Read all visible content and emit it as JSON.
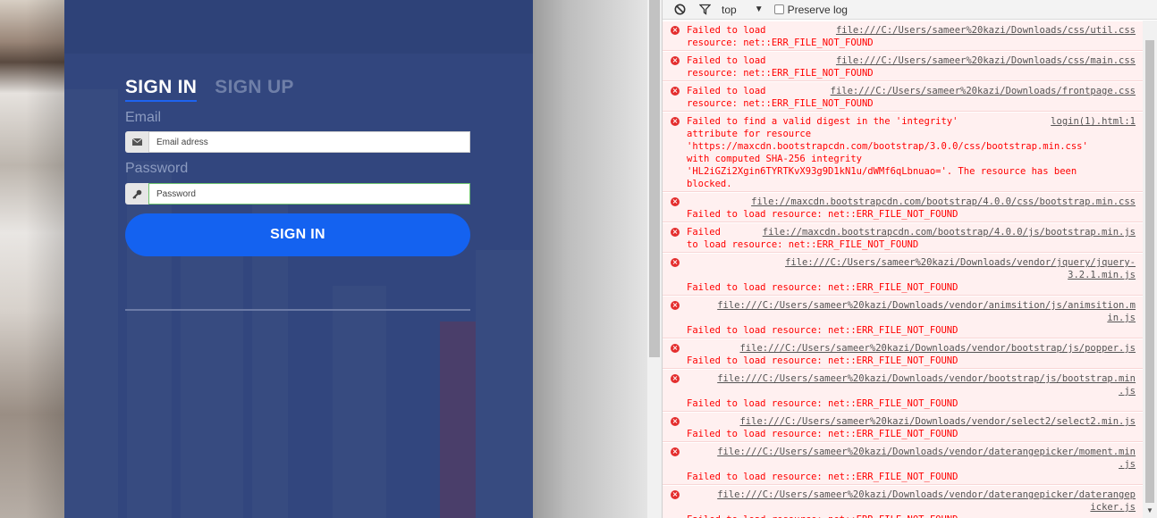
{
  "login": {
    "tabs": [
      "SIGN IN",
      "SIGN UP"
    ],
    "email_label": "Email",
    "email_placeholder": "Email adress",
    "password_label": "Password",
    "password_placeholder": "Password",
    "signin_button": "SIGN IN"
  },
  "console": {
    "context": "top",
    "preserve_log": "Preserve log",
    "entries": [
      {
        "lines": [
          [
            "Failed to load       ",
            "file:///C:/Users/sameer%20kazi/Downloads/css/util.css"
          ],
          [
            "resource: net::ERR_FILE_NOT_FOUND",
            ""
          ]
        ]
      },
      {
        "lines": [
          [
            "Failed to load       ",
            "file:///C:/Users/sameer%20kazi/Downloads/css/main.css"
          ],
          [
            "resource: net::ERR_FILE_NOT_FOUND",
            ""
          ]
        ]
      },
      {
        "lines": [
          [
            "Failed to load      ",
            "file:///C:/Users/sameer%20kazi/Downloads/frontpage.css"
          ],
          [
            "resource: net::ERR_FILE_NOT_FOUND",
            ""
          ]
        ]
      },
      {
        "lines": [
          [
            "Failed to find a valid digest in the 'integrity'",
            "login(1).html:1"
          ],
          [
            "attribute for resource",
            ""
          ],
          [
            "'https://maxcdn.bootstrapcdn.com/bootstrap/3.0.0/css/bootstrap.min.css'",
            ""
          ],
          [
            "with computed SHA-256 integrity",
            ""
          ],
          [
            "'HL2iGZi2Xgin6TYRTKvX93g9D1kN1u/dWMf6qLbnuao='. The resource has been",
            ""
          ],
          [
            "blocked.",
            ""
          ]
        ]
      },
      {
        "lines": [
          [
            "      ",
            "file://maxcdn.bootstrapcdn.com/bootstrap/4.0.0/css/bootstrap.min.css"
          ],
          [
            "Failed to load resource: net::ERR_FILE_NOT_FOUND",
            ""
          ]
        ]
      },
      {
        "lines": [
          [
            "Failed  ",
            "file://maxcdn.bootstrapcdn.com/bootstrap/4.0.0/js/bootstrap.min.js"
          ],
          [
            "to load resource: net::ERR_FILE_NOT_FOUND",
            ""
          ]
        ]
      },
      {
        "lines": [
          [
            "",
            "file:///C:/Users/sameer%20kazi/Downloads/vendor/jquery/jquery-"
          ],
          [
            "",
            "3.2.1.min.js"
          ],
          [
            "Failed to load resource: net::ERR_FILE_NOT_FOUND",
            ""
          ]
        ]
      },
      {
        "lines": [
          [
            "",
            "file:///C:/Users/sameer%20kazi/Downloads/vendor/animsition/js/animsition.m"
          ],
          [
            "",
            "in.js"
          ],
          [
            "Failed to load resource: net::ERR_FILE_NOT_FOUND",
            ""
          ]
        ]
      },
      {
        "lines": [
          [
            "    ",
            "file:///C:/Users/sameer%20kazi/Downloads/vendor/bootstrap/js/popper.js"
          ],
          [
            "Failed to load resource: net::ERR_FILE_NOT_FOUND",
            ""
          ]
        ]
      },
      {
        "lines": [
          [
            "",
            "file:///C:/Users/sameer%20kazi/Downloads/vendor/bootstrap/js/bootstrap.min"
          ],
          [
            "",
            ".js"
          ],
          [
            "Failed to load resource: net::ERR_FILE_NOT_FOUND",
            ""
          ]
        ]
      },
      {
        "lines": [
          [
            "    ",
            "file:///C:/Users/sameer%20kazi/Downloads/vendor/select2/select2.min.js"
          ],
          [
            "Failed to load resource: net::ERR_FILE_NOT_FOUND",
            ""
          ]
        ]
      },
      {
        "lines": [
          [
            "",
            "file:///C:/Users/sameer%20kazi/Downloads/vendor/daterangepicker/moment.min"
          ],
          [
            "",
            ".js"
          ],
          [
            "Failed to load resource: net::ERR_FILE_NOT_FOUND",
            ""
          ]
        ]
      },
      {
        "lines": [
          [
            "",
            "file:///C:/Users/sameer%20kazi/Downloads/vendor/daterangepicker/daterangep"
          ],
          [
            "",
            "icker.js"
          ],
          [
            "Failed to load resource: net::ERR_FILE_NOT_FOUND",
            ""
          ]
        ]
      }
    ]
  },
  "colors": {
    "card_bg": "#32467e",
    "accent_blue": "#1462f0",
    "error_red": "#ff0000",
    "error_bg": "#fff0f0"
  }
}
